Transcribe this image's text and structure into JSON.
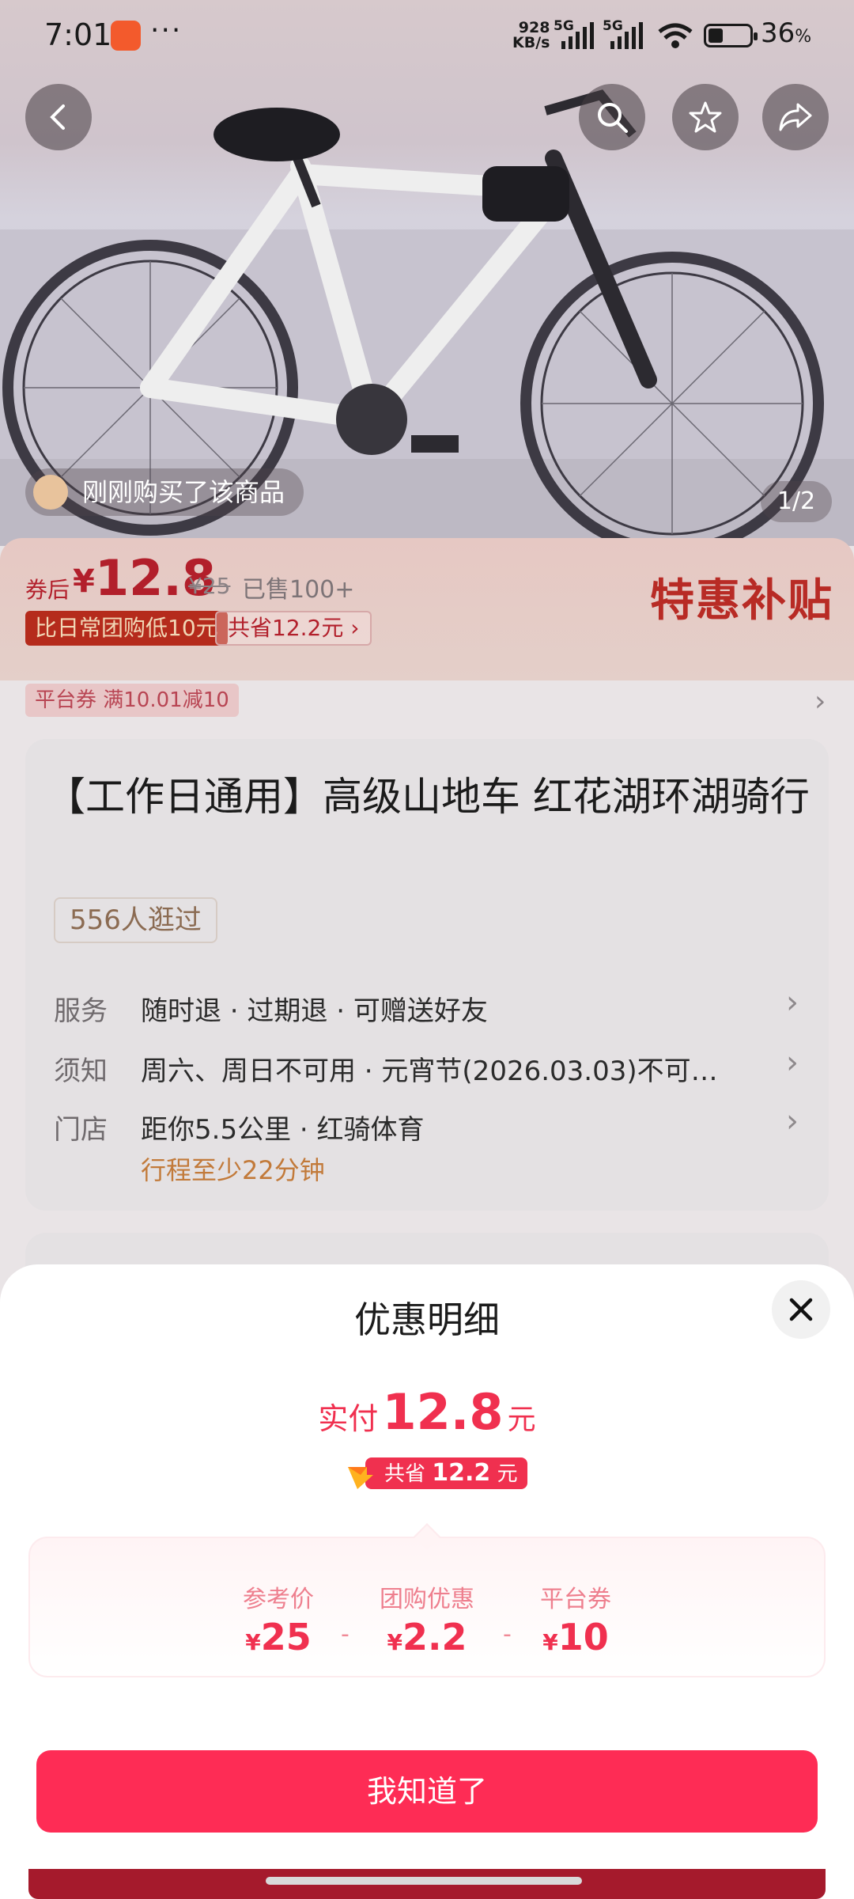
{
  "status_bar": {
    "time": "7:01",
    "more": "···",
    "net_speed_top": "928",
    "net_speed_bottom": "KB/s",
    "sig1": "5G",
    "sig2": "5G",
    "battery": "36",
    "battery_unit": "%"
  },
  "gallery": {
    "recent_buyer": "刚刚购买了该商品",
    "page_indicator": "1/2"
  },
  "price_bar": {
    "after_coupon_label": "券后",
    "currency": "¥",
    "price": "12.8",
    "original_price": "¥25",
    "sold": "已售100+",
    "lower_tag": "比日常团购低10元",
    "save_tag": "共省12.2元 ›",
    "promo_title": "特惠补贴"
  },
  "coupon": {
    "tag": "平台券  满10.01减10"
  },
  "product": {
    "title": "【工作日通用】高级山地车 红花湖环湖骑行",
    "visits": "556人逛过",
    "rows": [
      {
        "label": "服务",
        "value": "随时退 · 过期退 · 可赠送好友"
      },
      {
        "label": "须知",
        "value": "周六、周日不可用 · 元宵节(2026.03.03)不可…"
      },
      {
        "label": "门店",
        "value": "距你5.5公里 · 红骑体育",
        "sub": "行程至少22分钟"
      }
    ]
  },
  "sheet": {
    "title": "优惠明细",
    "pay_label": "实付",
    "pay_amount": "12.8",
    "pay_unit": "元",
    "save_label": "共省",
    "save_amount": "12.2",
    "save_unit": "元",
    "breakdown": [
      {
        "label": "参考价",
        "currency": "¥",
        "value": "25"
      },
      {
        "label": "团购优惠",
        "currency": "¥",
        "value": "2.2"
      },
      {
        "label": "平台券",
        "currency": "¥",
        "value": "10"
      }
    ],
    "separator": "-",
    "confirm_button": "我知道了"
  },
  "colors": {
    "accent": "#fe2c55",
    "price_red": "#f0304f",
    "scrim_price": "#b21f2b"
  }
}
